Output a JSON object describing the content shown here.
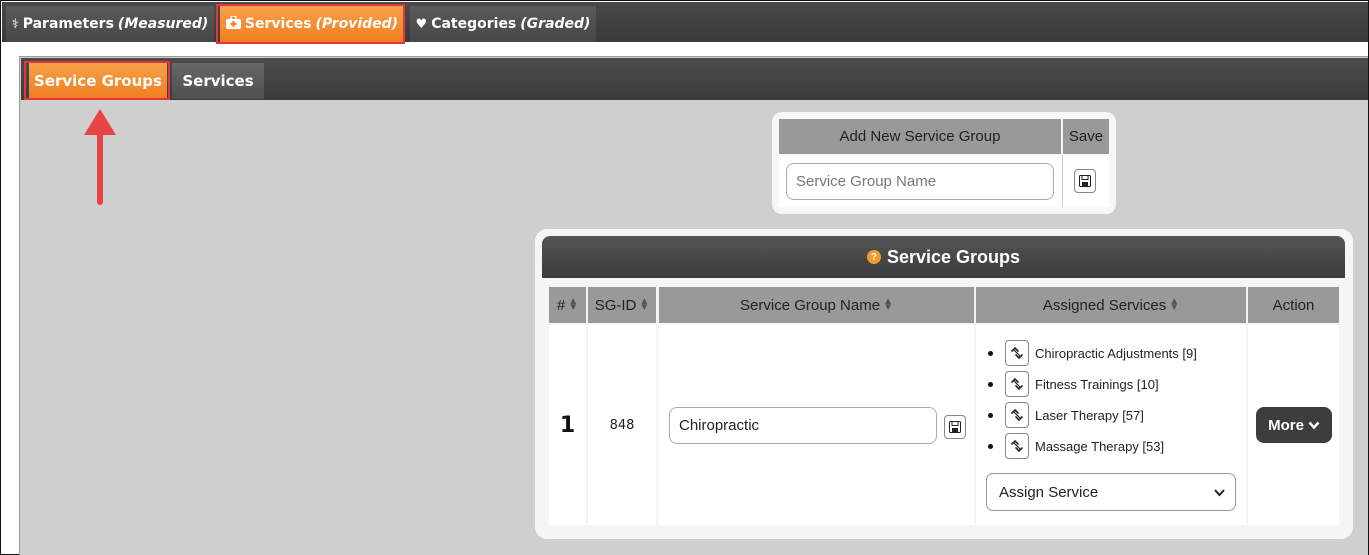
{
  "top_tabs": [
    {
      "label": "Parameters",
      "qualifier": "(Measured)",
      "icon": "stethoscope-icon"
    },
    {
      "label": "Services",
      "qualifier": "(Provided)",
      "icon": "medkit-icon"
    },
    {
      "label": "Categories",
      "qualifier": "(Graded)",
      "icon": "heartbeat-icon"
    }
  ],
  "sub_tabs": [
    {
      "label": "Service Groups"
    },
    {
      "label": "Services"
    }
  ],
  "add_panel": {
    "header_name": "Add New Service Group",
    "header_save": "Save",
    "input_placeholder": "Service Group Name"
  },
  "groups_panel": {
    "title": "Service Groups",
    "columns": [
      "#",
      "SG-ID",
      "Service Group Name",
      "Assigned Services",
      "Action"
    ],
    "rows": [
      {
        "index": "1",
        "sg_id": "848",
        "name": "Chiropractic",
        "services": [
          "Chiropractic Adjustments [9]",
          "Fitness Trainings [10]",
          "Laser Therapy [57]",
          "Massage Therapy [53]"
        ],
        "assign_select": "Assign Service",
        "more_label": "More"
      }
    ]
  },
  "colors": {
    "accent": "#f07e1f",
    "highlight": "#e2373c",
    "bar": "#3c3c3c"
  }
}
